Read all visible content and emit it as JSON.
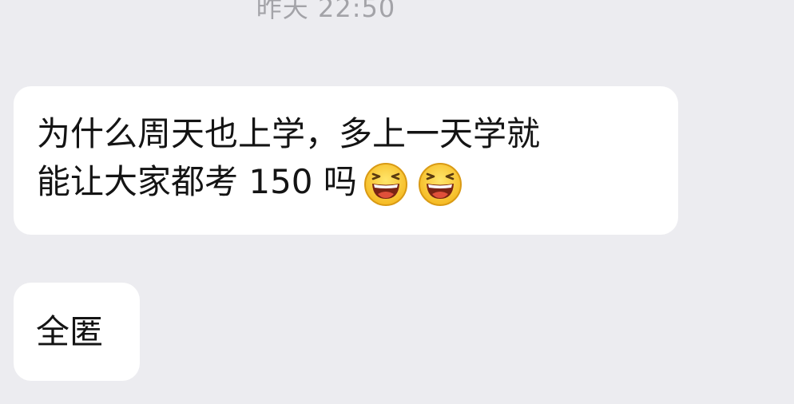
{
  "timestamp": "昨天 22:50",
  "messages": [
    {
      "line1": "为什么周天也上学，多上一天学就",
      "line2": "能让大家都考 150 吗",
      "emojis": [
        "laughing-face-icon",
        "laughing-face-icon"
      ]
    },
    {
      "text": "全匿"
    }
  ],
  "colors": {
    "background": "#ececf0",
    "bubble": "#ffffff",
    "text": "#141414",
    "timestamp": "#a3a3a8",
    "emoji_face": "#ffd52e",
    "emoji_mouth": "#e0503a"
  }
}
